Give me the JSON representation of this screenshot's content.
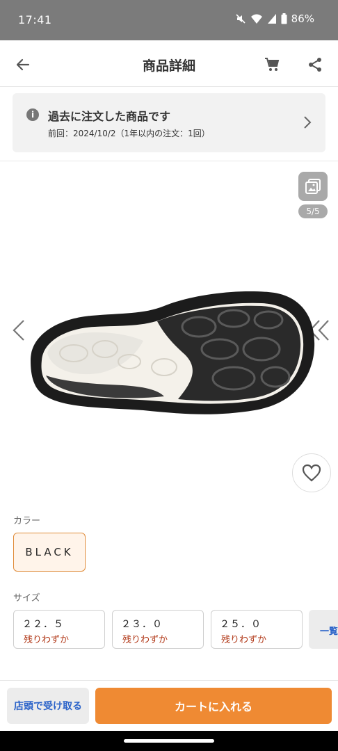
{
  "status_bar": {
    "time": "17:41",
    "battery": "86%"
  },
  "header": {
    "title": "商品詳細"
  },
  "order_banner": {
    "title": "過去に注文した商品です",
    "subtitle": "前回：2024/10/2（1年以内の注文：1回）"
  },
  "gallery": {
    "counter": "5/5"
  },
  "color": {
    "label": "カラー",
    "selected": "BLACK"
  },
  "size": {
    "label": "サイズ",
    "options": [
      {
        "value": "２２．５",
        "stock": "残りわずか"
      },
      {
        "value": "２３．０",
        "stock": "残りわずか"
      },
      {
        "value": "２５．０",
        "stock": "残りわずか"
      }
    ],
    "more_label": "一覧"
  },
  "actions": {
    "pickup_label": "店頭で受け取る",
    "add_to_cart_label": "カートに入れる"
  },
  "colors": {
    "accent": "#ef8a33",
    "link": "#2b63c9",
    "stock_warning": "#b23a1a"
  }
}
